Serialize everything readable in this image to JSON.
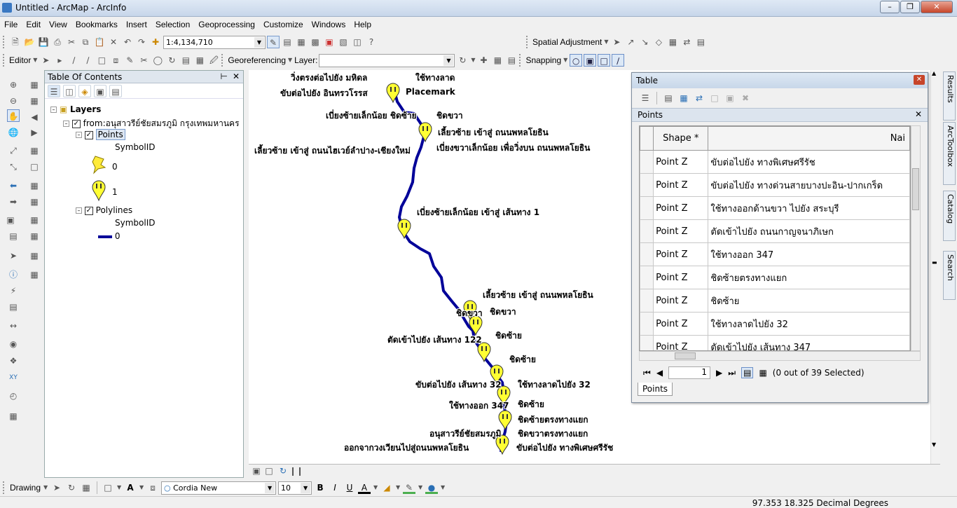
{
  "window": {
    "title": "Untitled - ArcMap - ArcInfo"
  },
  "menu": [
    "File",
    "Edit",
    "View",
    "Bookmarks",
    "Insert",
    "Selection",
    "Geoprocessing",
    "Customize",
    "Windows",
    "Help"
  ],
  "toolbar1": {
    "scale": "1:4,134,710",
    "spatial_adjustment": "Spatial Adjustment"
  },
  "toolbar2": {
    "editor": "Editor",
    "georeferencing": "Georeferencing",
    "layer_label": "Layer:",
    "layer_value": "",
    "snapping": "Snapping"
  },
  "toc": {
    "title": "Table Of Contents",
    "layers_label": "Layers",
    "group_label": "from:อนุสาวรีย์ชัยสมรภูมิ กรุงเทพมหานคร to:",
    "points": {
      "name": "Points",
      "field": "SymbolID",
      "values": [
        "0",
        "1"
      ]
    },
    "polylines": {
      "name": "Polylines",
      "field": "SymbolID",
      "values": [
        "0"
      ]
    }
  },
  "map_labels": [
    "วิ่งตรงต่อไปยัง มหิดล",
    "ใช้ทางลาด",
    "ขับต่อไปยัง อินทรวโรรส",
    "Placemark",
    "เบี่ยงซ้ายเล็กน้อย ชิดซ้าย",
    "ชิดขวา",
    "เลี้ยวซ้าย เข้าสู่ ถนนพหลโยธิน",
    "เลี้ยวซ้าย เข้าสู่ ถนนไฮเวย์ลำปาง-เชียงใหม่",
    "เบี่ยงขวาเล็กน้อย เพื่อวิ่งบน ถนนพหลโยธิน",
    "เบี่ยงซ้ายเล็กน้อย เข้าสู่ เส้นทาง 1",
    "เลี้ยวซ้าย เข้าสู่ ถนนพหลโยธิน",
    "ชิดขวา",
    "ชิดขวา",
    "ตัดเข้าไปยัง เส้นทาง 122",
    "ชิดซ้าย",
    "ชิดซ้าย",
    "ขับต่อไปยัง เส้นทาง 32",
    "ใช้ทางลาดไปยัง 32",
    "ใช้ทางออก 347",
    "ชิดซ้าย",
    "ชิดซ้ายตรงทางแยก",
    "อนุสาวรีย์ชัยสมรภูมิ",
    "ชิดขวาตรงทางแยก",
    "ออกจากวงเวียนไปสู่ถนนพหลโยธิน",
    "ขับต่อไปยัง ทางพิเศษศรีรัช"
  ],
  "table_window": {
    "title": "Table",
    "tab_header": "Points",
    "columns": [
      "Shape *",
      "Nai"
    ],
    "rows": [
      {
        "shape": "Point Z",
        "name": "ขับต่อไปยัง ทางพิเศษศรีรัช"
      },
      {
        "shape": "Point Z",
        "name": "ขับต่อไปยัง ทางด่วนสายบางปะอิน-ปากเกร็ด"
      },
      {
        "shape": "Point Z",
        "name": "ใช้ทางออกด้านขวา ไปยัง สระบุรี"
      },
      {
        "shape": "Point Z",
        "name": "ตัดเข้าไปยัง ถนนกาญจนาภิเษก"
      },
      {
        "shape": "Point Z",
        "name": "ใช้ทางออก 347"
      },
      {
        "shape": "Point Z",
        "name": "ชิดซ้ายตรงทางแยก"
      },
      {
        "shape": "Point Z",
        "name": "ชิดซ้าย"
      },
      {
        "shape": "Point Z",
        "name": "ใช้ทางลาดไปยัง 32"
      },
      {
        "shape": "Point Z",
        "name": "ตัดเข้าไปยัง เส้นทาง 347"
      }
    ],
    "record": "1",
    "selection": "(0 out of 39 Selected)",
    "bottom_tab": "Points"
  },
  "right_dock": [
    "Results",
    "ArcToolbox",
    "Catalog",
    "Search"
  ],
  "drawing": {
    "label": "Drawing",
    "font": "Cordia New",
    "size": "10"
  },
  "status": {
    "coords": "97.353  18.325 Decimal Degrees"
  },
  "colors": {
    "route": "#000099",
    "marker": "#ffff33",
    "accent": "#3a78c2"
  }
}
